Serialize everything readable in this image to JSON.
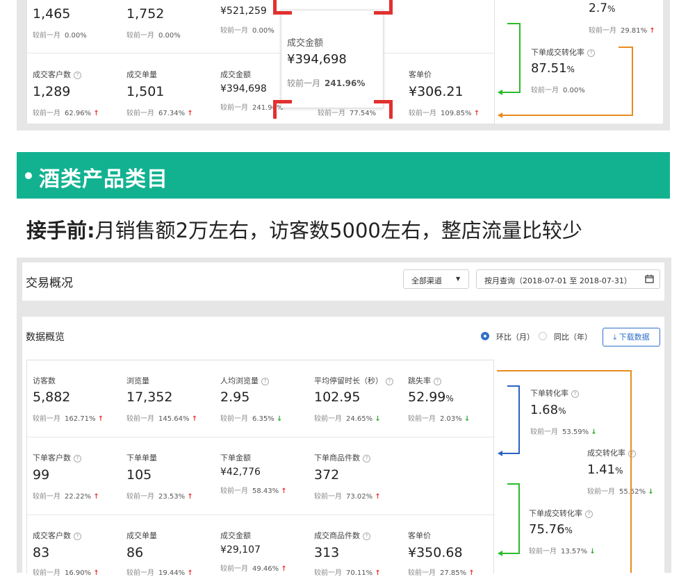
{
  "top": {
    "row1": [
      {
        "value": "1,465",
        "cmp": "较前一月",
        "pct": "0.00%"
      },
      {
        "value": "1,752",
        "cmp": "较前一月",
        "pct": "0.00%"
      },
      {
        "value": "¥521,259",
        "cmp": "较前一月",
        "pct": "0.00%"
      }
    ],
    "row2": [
      {
        "label": "成交客户数",
        "value": "1,289",
        "cmp": "较前一月",
        "pct": "62.96%"
      },
      {
        "label": "成交单量",
        "value": "1,501",
        "cmp": "较前一月",
        "pct": "67.34%"
      },
      {
        "label": "成交金额",
        "value": "¥394,698",
        "cmp": "较前一月",
        "pct": "241.96%"
      },
      {
        "cmp": "较前一月",
        "pct": "77.54%"
      },
      {
        "label": "客单价",
        "value": "¥306.21",
        "cmp": "较前一月",
        "pct": "109.85%"
      }
    ],
    "right": {
      "v1": "2.7",
      "v1unit": "%",
      "v1cmp": "较前一月",
      "v1pct": "29.81%",
      "label2": "下单成交转化率",
      "v2": "87.51",
      "v2unit": "%",
      "v2cmp": "较前一月",
      "v2pct": "0.00%"
    },
    "tooltip": {
      "title": "成交金额",
      "value": "¥394,698",
      "cmp": "较前一月",
      "pct": "241.96%"
    }
  },
  "banner": {
    "title": "酒类产品类目"
  },
  "headline": {
    "bold": "接手前:",
    "text": "月销售额2万左右，访客数5000左右，整店流量比较少"
  },
  "header": {
    "title": "交易概况",
    "channel": "全部渠道",
    "date": "按月查询（2018-07-01 至 2018-07-31）"
  },
  "overview": {
    "title": "数据概览",
    "radio1": "环比（月）",
    "radio2": "同比（年）",
    "download": "下载数据"
  },
  "grid": {
    "row1": [
      {
        "label": "访客数",
        "value": "5,882",
        "cmp": "较前一月",
        "pct": "162.71%",
        "dir": "up"
      },
      {
        "label": "浏览量",
        "value": "17,352",
        "cmp": "较前一月",
        "pct": "145.64%",
        "dir": "up"
      },
      {
        "label": "人均浏览量",
        "value": "2.95",
        "cmp": "较前一月",
        "pct": "6.35%",
        "dir": "down"
      },
      {
        "label": "平均停留时长（秒）",
        "value": "102.95",
        "cmp": "较前一月",
        "pct": "24.65%",
        "dir": "down"
      },
      {
        "label": "跳失率",
        "value": "52.99",
        "unit": "%",
        "cmp": "较前一月",
        "pct": "2.03%",
        "dir": "down"
      }
    ],
    "row2": [
      {
        "label": "下单客户数",
        "value": "99",
        "cmp": "较前一月",
        "pct": "22.22%",
        "dir": "up"
      },
      {
        "label": "下单单量",
        "value": "105",
        "cmp": "较前一月",
        "pct": "23.53%",
        "dir": "up"
      },
      {
        "label": "下单金额",
        "value": "¥42,776",
        "cmp": "较前一月",
        "pct": "58.43%",
        "dir": "up"
      },
      {
        "label": "下单商品件数",
        "value": "372",
        "cmp": "较前一月",
        "pct": "73.02%",
        "dir": "up"
      }
    ],
    "row3": [
      {
        "label": "成交客户数",
        "value": "83",
        "cmp": "较前一月",
        "pct": "16.90%"
      },
      {
        "label": "成交单量",
        "value": "86",
        "cmp": "较前一月",
        "pct": "19.44%"
      },
      {
        "label": "成交金额",
        "value": "¥29,107",
        "cmp": "较前一月",
        "pct": "49.46%"
      },
      {
        "label": "成交商品件数",
        "value": "313",
        "cmp": "较前一月",
        "pct": "70.11%"
      },
      {
        "label": "客单价",
        "value": "¥350.68",
        "cmp": "较前一月",
        "pct": "27.85%"
      }
    ]
  },
  "funnel": {
    "c1": {
      "label": "下单转化率",
      "value": "1.68",
      "unit": "%",
      "cmp": "较前一月",
      "pct": "53.59%"
    },
    "c2": {
      "label": "成交转化率",
      "value": "1.41",
      "unit": "%",
      "cmp": "较前一月",
      "pct": "55.52%"
    },
    "c3": {
      "label": "下单成交转化率",
      "value": "75.76",
      "unit": "%",
      "cmp": "较前一月",
      "pct": "13.57%"
    }
  },
  "colors": {
    "brand": "#12b291",
    "up": "#e33333",
    "down": "#22aa22",
    "link": "#2f6fc9",
    "highlight": "#e23030"
  }
}
